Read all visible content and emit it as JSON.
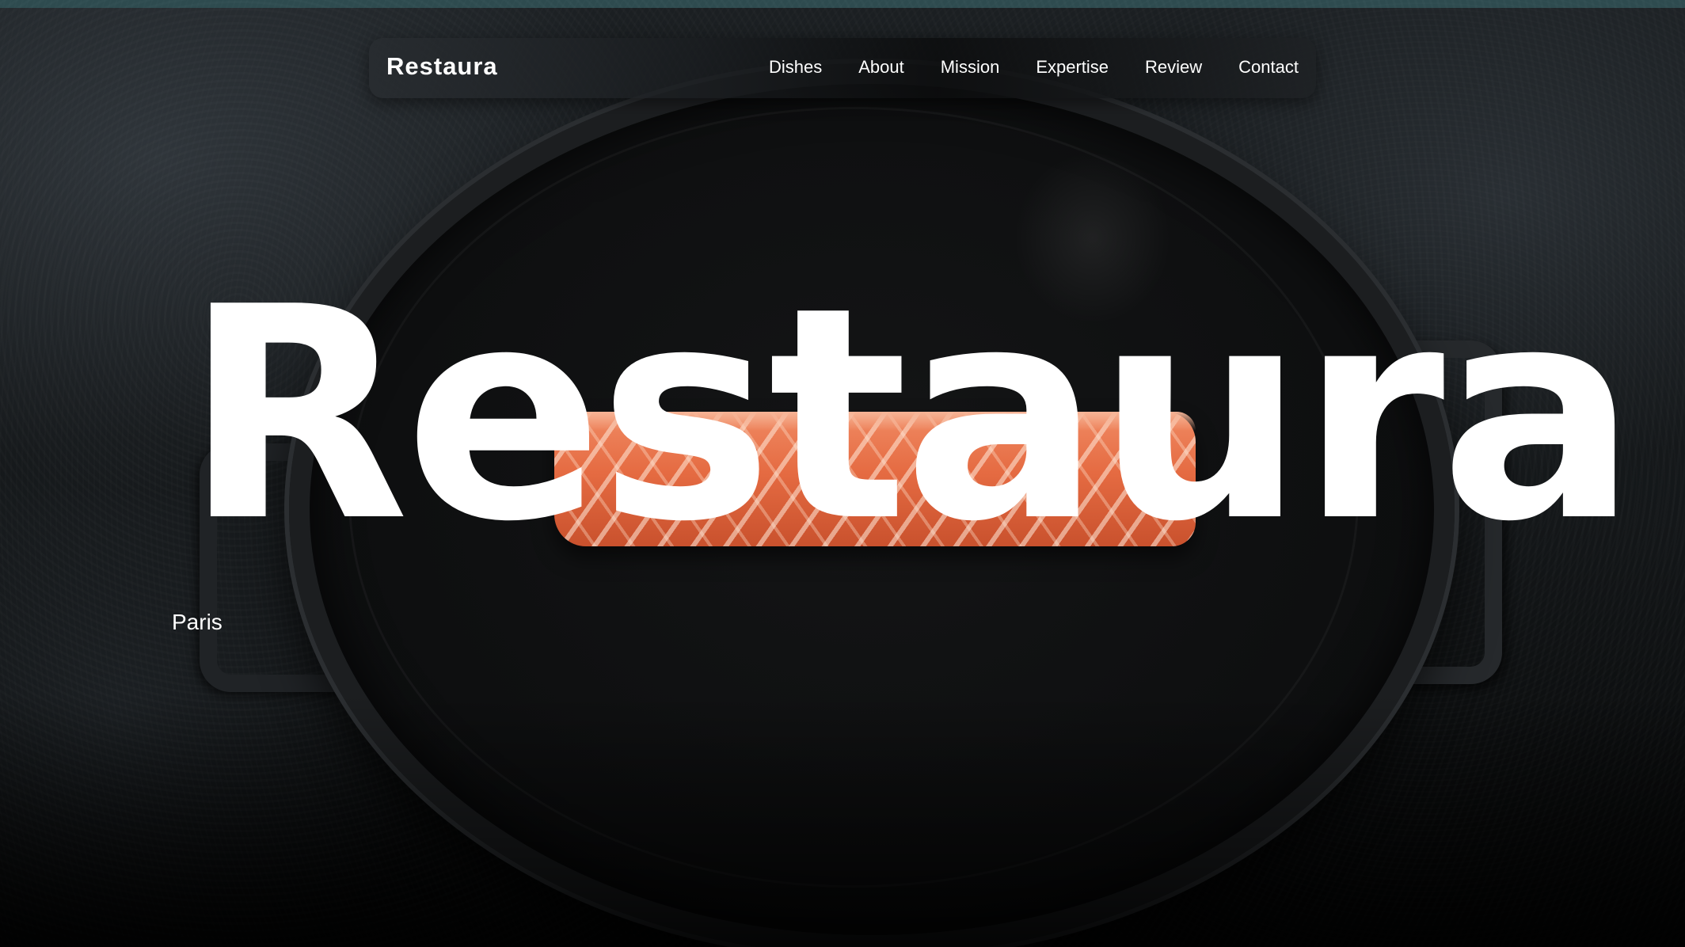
{
  "header": {
    "logo": "Restaura",
    "nav": [
      "Dishes",
      "About",
      "Mission",
      "Expertise",
      "Review",
      "Contact"
    ]
  },
  "hero": {
    "title": "Restaura",
    "city": "Paris"
  },
  "colors": {
    "top_strip": "#2e4b4f",
    "background": "#141719",
    "text": "#ffffff",
    "salmon": "#e56b42"
  }
}
